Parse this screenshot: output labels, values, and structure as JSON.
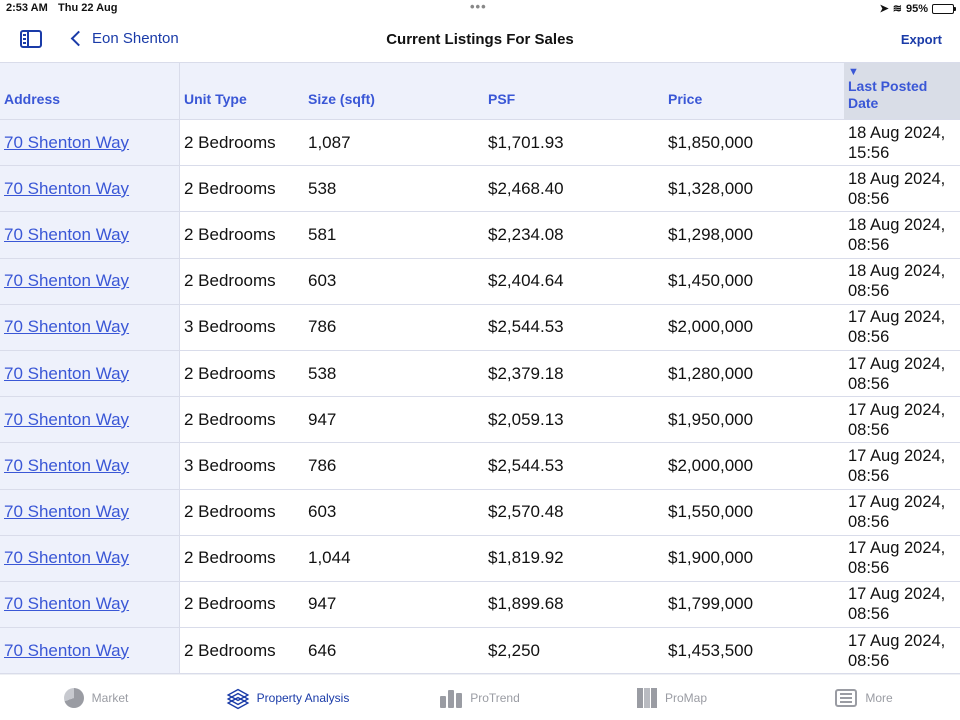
{
  "status": {
    "time": "2:53 AM",
    "date": "Thu 22 Aug",
    "battery": "95%",
    "battery_level": 0.95
  },
  "nav": {
    "back_label": "Eon Shenton",
    "title": "Current Listings For Sales",
    "export_label": "Export"
  },
  "table": {
    "headers": {
      "address": "Address",
      "unit_type": "Unit Type",
      "size": "Size (sqft)",
      "psf": "PSF",
      "price": "Price",
      "date": "Last Posted Date"
    },
    "sort": {
      "column": "date",
      "direction": "descending"
    },
    "rows": [
      {
        "address": "70 Shenton Way",
        "unit_type": "2 Bedrooms",
        "size": "1,087",
        "psf": "$1,701.93",
        "price": "$1,850,000",
        "date": "18 Aug 2024, 15:56"
      },
      {
        "address": "70 Shenton Way",
        "unit_type": "2 Bedrooms",
        "size": "538",
        "psf": "$2,468.40",
        "price": "$1,328,000",
        "date": "18 Aug 2024, 08:56"
      },
      {
        "address": "70 Shenton Way",
        "unit_type": "2 Bedrooms",
        "size": "581",
        "psf": "$2,234.08",
        "price": "$1,298,000",
        "date": "18 Aug 2024, 08:56"
      },
      {
        "address": "70 Shenton Way",
        "unit_type": "2 Bedrooms",
        "size": "603",
        "psf": "$2,404.64",
        "price": "$1,450,000",
        "date": "18 Aug 2024, 08:56"
      },
      {
        "address": "70 Shenton Way",
        "unit_type": "3 Bedrooms",
        "size": "786",
        "psf": "$2,544.53",
        "price": "$2,000,000",
        "date": "17 Aug 2024, 08:56"
      },
      {
        "address": "70 Shenton Way",
        "unit_type": "2 Bedrooms",
        "size": "538",
        "psf": "$2,379.18",
        "price": "$1,280,000",
        "date": "17 Aug 2024, 08:56"
      },
      {
        "address": "70 Shenton Way",
        "unit_type": "2 Bedrooms",
        "size": "947",
        "psf": "$2,059.13",
        "price": "$1,950,000",
        "date": "17 Aug 2024, 08:56"
      },
      {
        "address": "70 Shenton Way",
        "unit_type": "3 Bedrooms",
        "size": "786",
        "psf": "$2,544.53",
        "price": "$2,000,000",
        "date": "17 Aug 2024, 08:56"
      },
      {
        "address": "70 Shenton Way",
        "unit_type": "2 Bedrooms",
        "size": "603",
        "psf": "$2,570.48",
        "price": "$1,550,000",
        "date": "17 Aug 2024, 08:56"
      },
      {
        "address": "70 Shenton Way",
        "unit_type": "2 Bedrooms",
        "size": "1,044",
        "psf": "$1,819.92",
        "price": "$1,900,000",
        "date": "17 Aug 2024, 08:56"
      },
      {
        "address": "70 Shenton Way",
        "unit_type": "2 Bedrooms",
        "size": "947",
        "psf": "$1,899.68",
        "price": "$1,799,000",
        "date": "17 Aug 2024, 08:56"
      },
      {
        "address": "70 Shenton Way",
        "unit_type": "2 Bedrooms",
        "size": "646",
        "psf": "$2,250",
        "price": "$1,453,500",
        "date": "17 Aug 2024, 08:56"
      }
    ]
  },
  "tabs": [
    {
      "label": "Market",
      "icon": "pie-chart-icon",
      "active": false
    },
    {
      "label": "Property Analysis",
      "icon": "layers-icon",
      "active": true
    },
    {
      "label": "ProTrend",
      "icon": "bar-chart-icon",
      "active": false
    },
    {
      "label": "ProMap",
      "icon": "map-icon",
      "active": false
    },
    {
      "label": "More",
      "icon": "list-icon",
      "active": false
    }
  ],
  "colors": {
    "accent": "#1a3ba8",
    "link": "#3a57d6",
    "header_bg": "#eef1fb",
    "sorted_header_bg": "#d9dde7",
    "inactive_tab": "#9a9ca3"
  }
}
